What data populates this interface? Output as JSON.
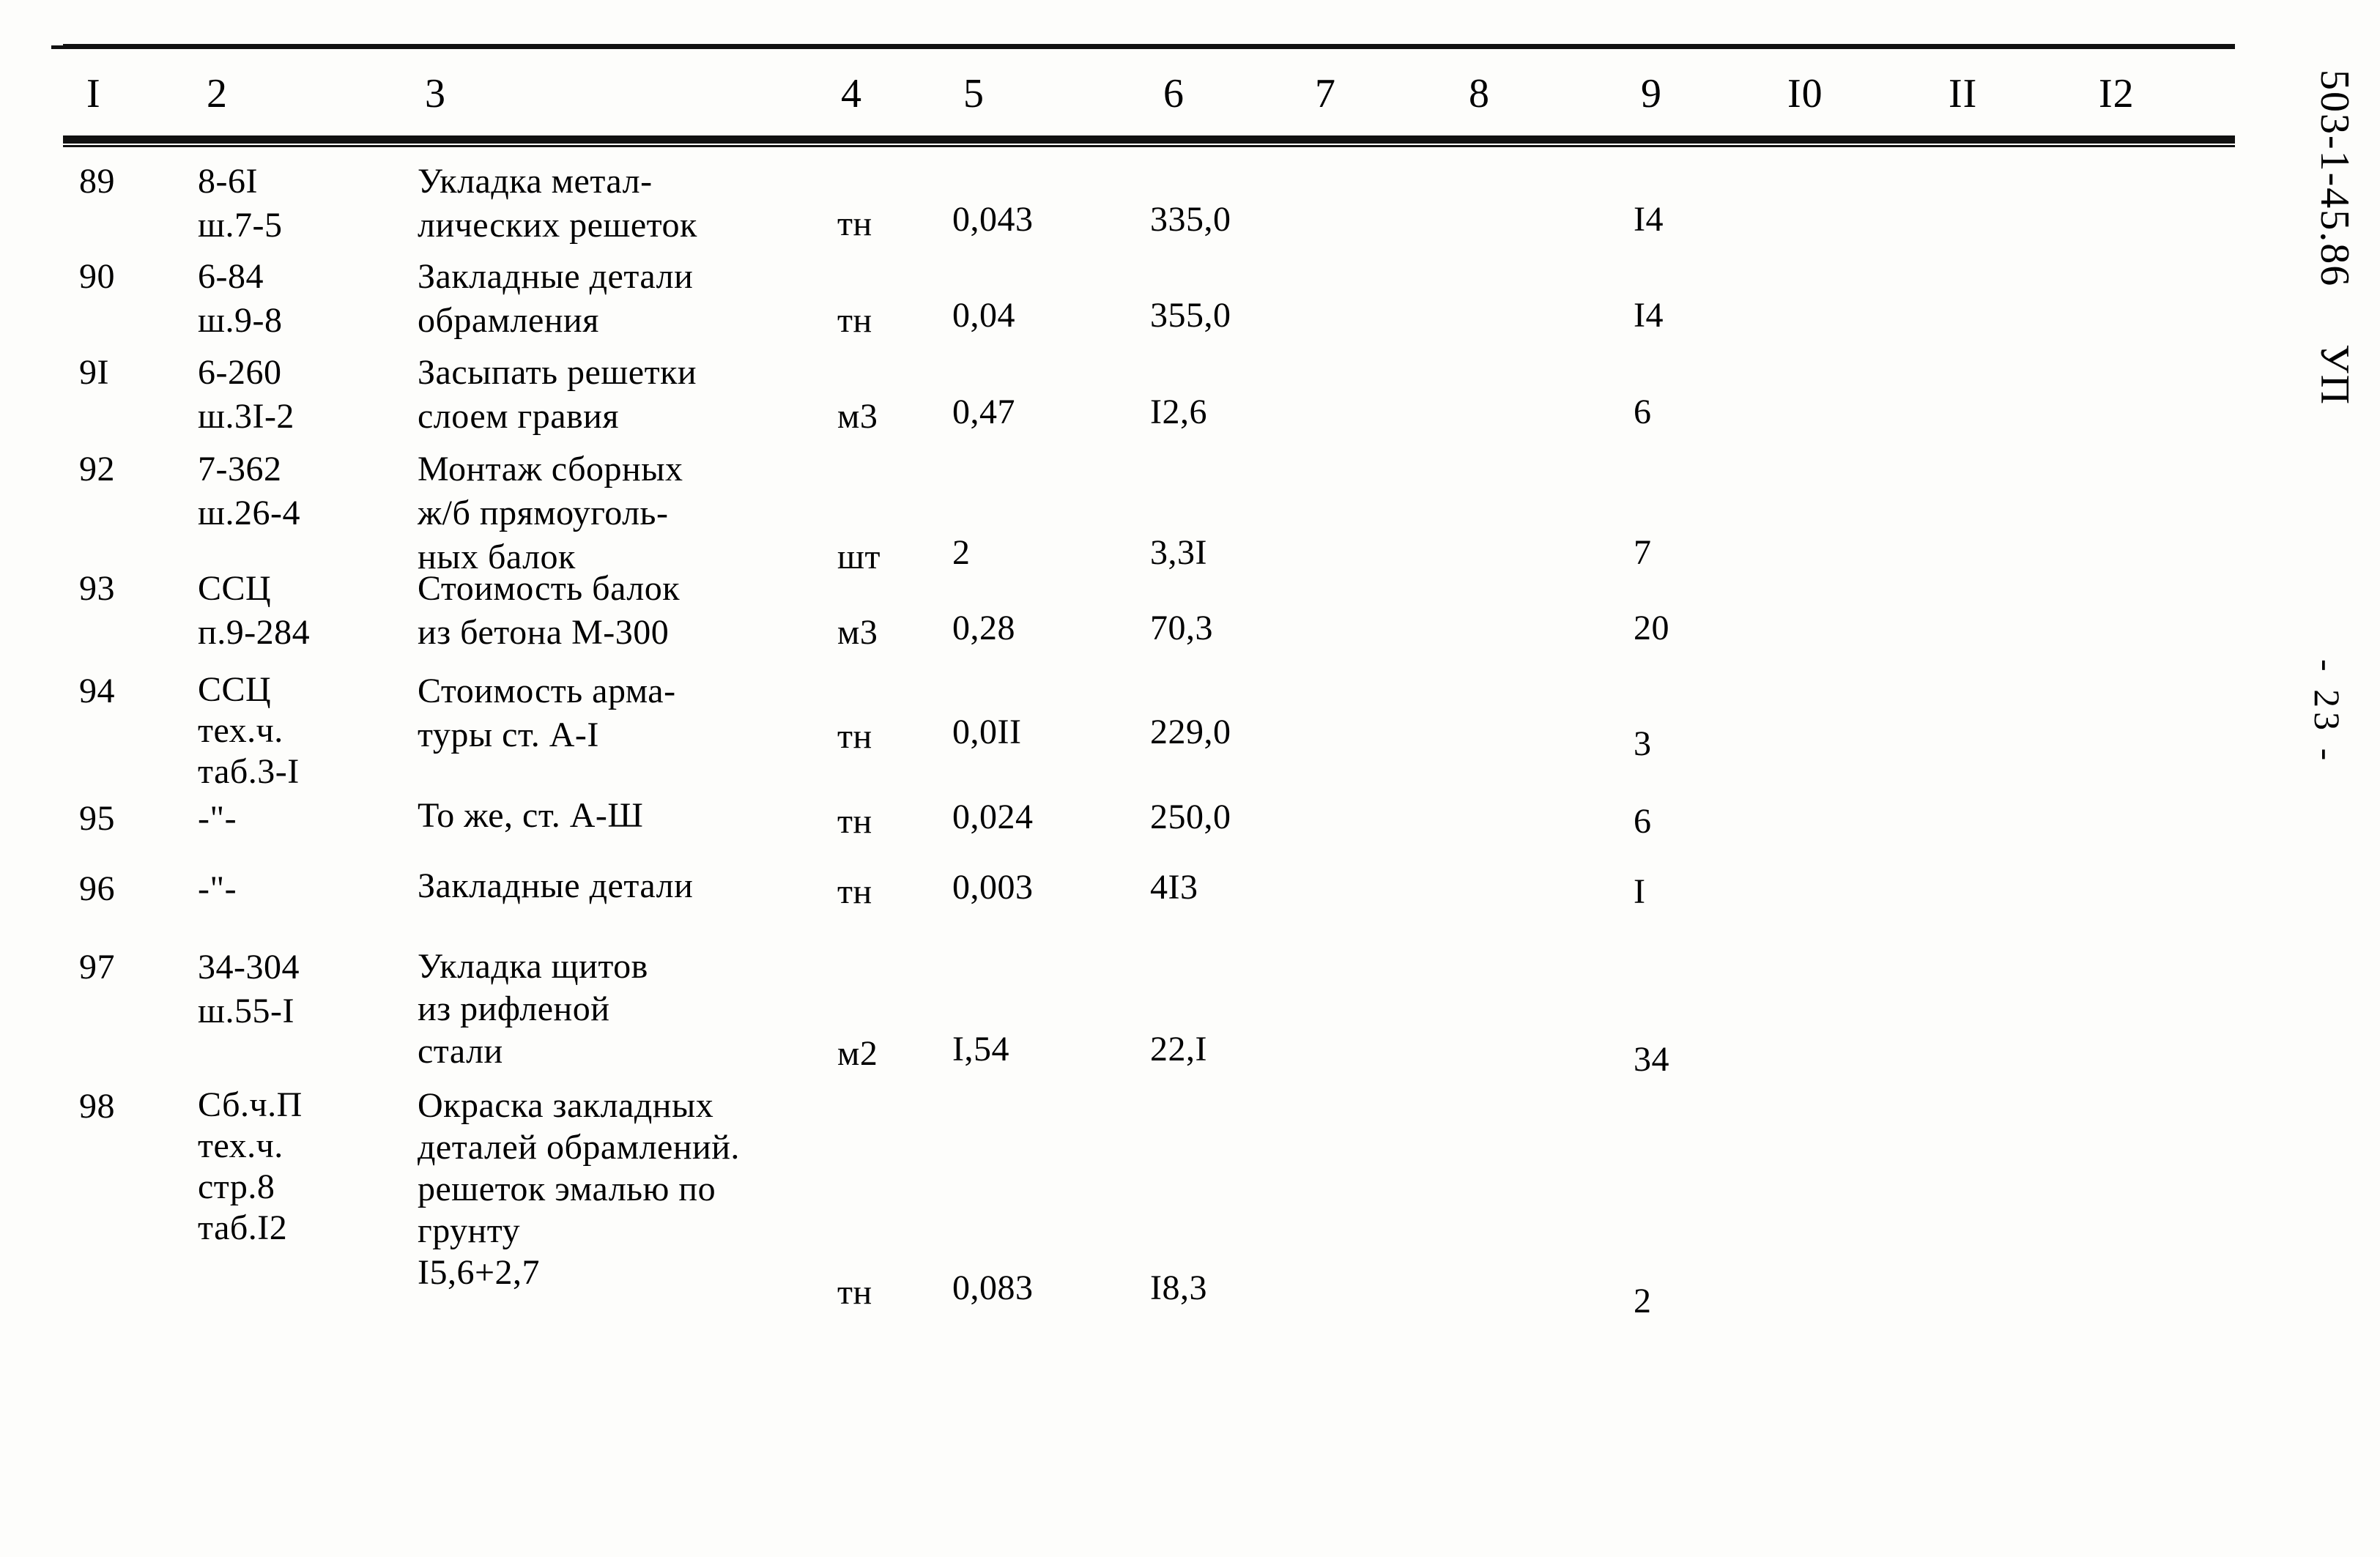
{
  "document": {
    "code": "503-1-45.86",
    "sheet": "УП",
    "page_marker": "- 23 -"
  },
  "table": {
    "headers": [
      "I",
      "2",
      "3",
      "4",
      "5",
      "6",
      "7",
      "8",
      "9",
      "I0",
      "II",
      "I2"
    ],
    "rows": [
      {
        "pos": "89",
        "code": "8-6I\nш.7-5",
        "desc": "Укладка метал-\nлических решеток",
        "unit": "тн",
        "qty": "0,043",
        "price": "335,0",
        "c7": "",
        "c8": "",
        "c9": "I4",
        "c10": "",
        "c11": "",
        "c12": ""
      },
      {
        "pos": "90",
        "code": "6-84\nш.9-8",
        "desc": "Закладные детали\nобрамления",
        "unit": "тн",
        "qty": "0,04",
        "price": "355,0",
        "c7": "",
        "c8": "",
        "c9": "I4",
        "c10": "",
        "c11": "",
        "c12": ""
      },
      {
        "pos": "9I",
        "code": "6-260\nш.3I-2",
        "desc": "Засыпать решетки\nслоем гравия",
        "unit": "м3",
        "qty": "0,47",
        "price": "I2,6",
        "c7": "",
        "c8": "",
        "c9": "6",
        "c10": "",
        "c11": "",
        "c12": ""
      },
      {
        "pos": "92",
        "code": "7-362\nш.26-4",
        "desc": "Монтаж сборных\nж/б прямоуголь-\nных балок",
        "unit": "шт",
        "qty": "2",
        "price": "3,3I",
        "c7": "",
        "c8": "",
        "c9": "7",
        "c10": "",
        "c11": "",
        "c12": ""
      },
      {
        "pos": "93",
        "code": "ССЦ\nп.9-284",
        "desc": "Стоимость балок\nиз бетона М-300",
        "unit": "м3",
        "qty": "0,28",
        "price": "70,3",
        "c7": "",
        "c8": "",
        "c9": "20",
        "c10": "",
        "c11": "",
        "c12": ""
      },
      {
        "pos": "94",
        "code": "ССЦ\nтех.ч.\nтаб.3-I",
        "desc": "Стоимость арма-\nтуры ст. А-I",
        "unit": "тн",
        "qty": "0,0II",
        "price": "229,0",
        "c7": "",
        "c8": "",
        "c9": "3",
        "c10": "",
        "c11": "",
        "c12": ""
      },
      {
        "pos": "95",
        "code": "-\"-",
        "desc": "То же, ст. А-Ш",
        "unit": "тн",
        "qty": "0,024",
        "price": "250,0",
        "c7": "",
        "c8": "",
        "c9": "6",
        "c10": "",
        "c11": "",
        "c12": ""
      },
      {
        "pos": "96",
        "code": "-\"-",
        "desc": "Закладные детали",
        "unit": "тн",
        "qty": "0,003",
        "price": "4I3",
        "c7": "",
        "c8": "",
        "c9": "I",
        "c10": "",
        "c11": "",
        "c12": ""
      },
      {
        "pos": "97",
        "code": "34-304\nш.55-I",
        "desc": "Укладка щитов\nиз рифленой\nстали",
        "unit": "м2",
        "qty": "I,54",
        "price": "22,I",
        "c7": "",
        "c8": "",
        "c9": "34",
        "c10": "",
        "c11": "",
        "c12": ""
      },
      {
        "pos": "98",
        "code": "Сб.ч.П\nтех.ч.\nстр.8\nтаб.I2",
        "desc": "Окраска закладных\nдеталей обрамлений.\nрешеток эмалью по\nгрунту\nI5,6+2,7",
        "unit": "тн",
        "qty": "0,083",
        "price": "I8,3",
        "c7": "",
        "c8": "",
        "c9": "2",
        "c10": "",
        "c11": "",
        "c12": ""
      }
    ]
  }
}
